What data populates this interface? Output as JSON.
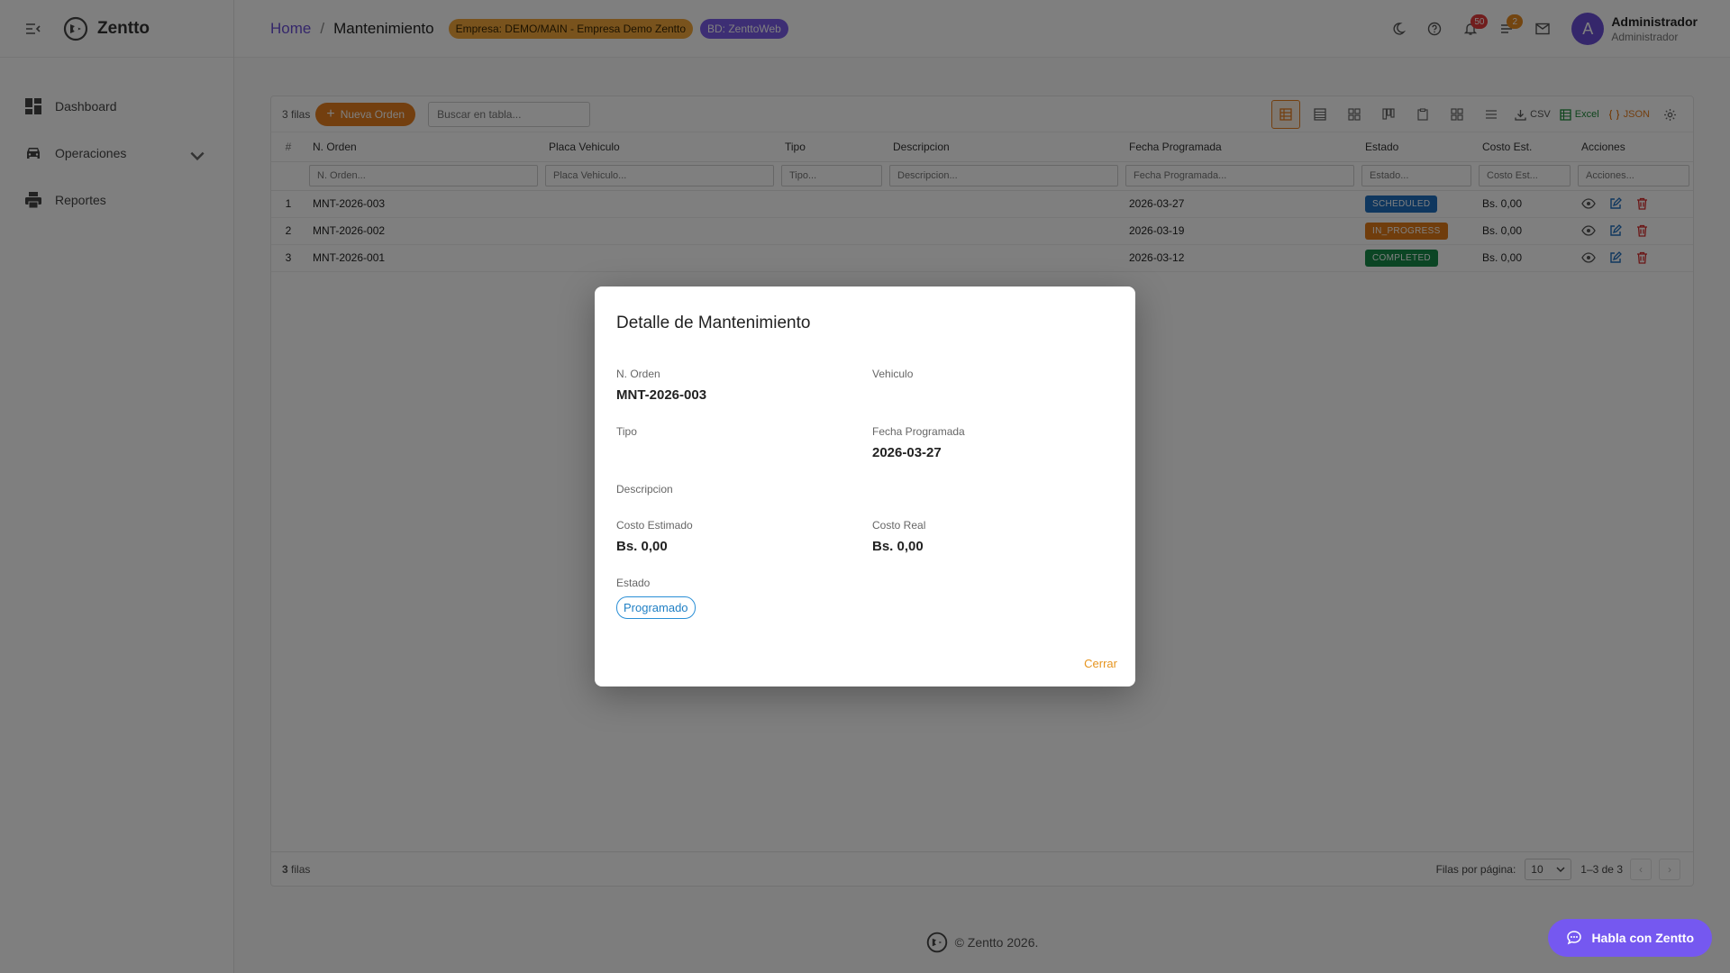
{
  "app": {
    "brand": "Zentto"
  },
  "sidebar": {
    "items": [
      {
        "label": "Dashboard",
        "icon": "dashboard-icon"
      },
      {
        "label": "Operaciones",
        "icon": "car-icon"
      },
      {
        "label": "Reportes",
        "icon": "printer-icon"
      }
    ]
  },
  "header": {
    "breadcrumb_home": "Home",
    "breadcrumb_sep": "/",
    "breadcrumb_current": "Mantenimiento",
    "chip_empresa": "Empresa: DEMO/MAIN - Empresa Demo Zentto",
    "chip_bd": "BD: ZenttoWeb",
    "notifications_count": "50",
    "tasks_count": "2",
    "avatar_initial": "A",
    "user_name": "Administrador",
    "user_role": "Administrador"
  },
  "toolbar": {
    "rows_count": "3 filas",
    "new_button": "Nueva Orden",
    "search_placeholder": "Buscar en tabla...",
    "csv_label": "CSV",
    "excel_label": "Excel",
    "json_label": "JSON"
  },
  "table": {
    "columns": [
      "#",
      "N. Orden",
      "Placa Vehiculo",
      "Tipo",
      "Descripcion",
      "Fecha Programada",
      "Estado",
      "Costo Est.",
      "Acciones"
    ],
    "filters": [
      "N. Orden...",
      "Placa Vehiculo...",
      "Tipo...",
      "Descripcion...",
      "Fecha Programada...",
      "Estado...",
      "Costo Est...",
      "Acciones..."
    ],
    "rows": [
      {
        "n": "1",
        "orden": "MNT-2026-003",
        "placa": "",
        "tipo": "",
        "descripcion": "",
        "fecha": "2026-03-27",
        "estado": "SCHEDULED",
        "costo": "Bs. 0,00"
      },
      {
        "n": "2",
        "orden": "MNT-2026-002",
        "placa": "",
        "tipo": "",
        "descripcion": "",
        "fecha": "2026-03-19",
        "estado": "IN_PROGRESS",
        "costo": "Bs. 0,00"
      },
      {
        "n": "3",
        "orden": "MNT-2026-001",
        "placa": "",
        "tipo": "",
        "descripcion": "",
        "fecha": "2026-03-12",
        "estado": "COMPLETED",
        "costo": "Bs. 0,00"
      }
    ]
  },
  "table_footer": {
    "rows_num": "3",
    "rows_word": "filas",
    "per_page_label": "Filas por página:",
    "per_page_value": "10",
    "range": "1–3 de 3",
    "prev": "‹",
    "next": "›"
  },
  "footer": {
    "copyright": "© Zentto 2026."
  },
  "chat": {
    "label": "Habla con Zentto"
  },
  "modal": {
    "title": "Detalle de Mantenimiento",
    "orden_label": "N. Orden",
    "orden_value": "MNT-2026-003",
    "vehiculo_label": "Vehiculo",
    "vehiculo_value": "",
    "tipo_label": "Tipo",
    "tipo_value": "",
    "fecha_label": "Fecha Programada",
    "fecha_value": "2026-03-27",
    "descripcion_label": "Descripcion",
    "costo_est_label": "Costo Estimado",
    "costo_est_value": "Bs. 0,00",
    "costo_real_label": "Costo Real",
    "costo_real_value": "Bs. 0,00",
    "estado_label": "Estado",
    "estado_value": "Programado",
    "close_label": "Cerrar"
  },
  "colors": {
    "accent": "#e67e1e",
    "brand": "#6b4fd6",
    "scheduled": "#1e6fbf",
    "in_progress": "#e07a18",
    "completed": "#168a48"
  }
}
